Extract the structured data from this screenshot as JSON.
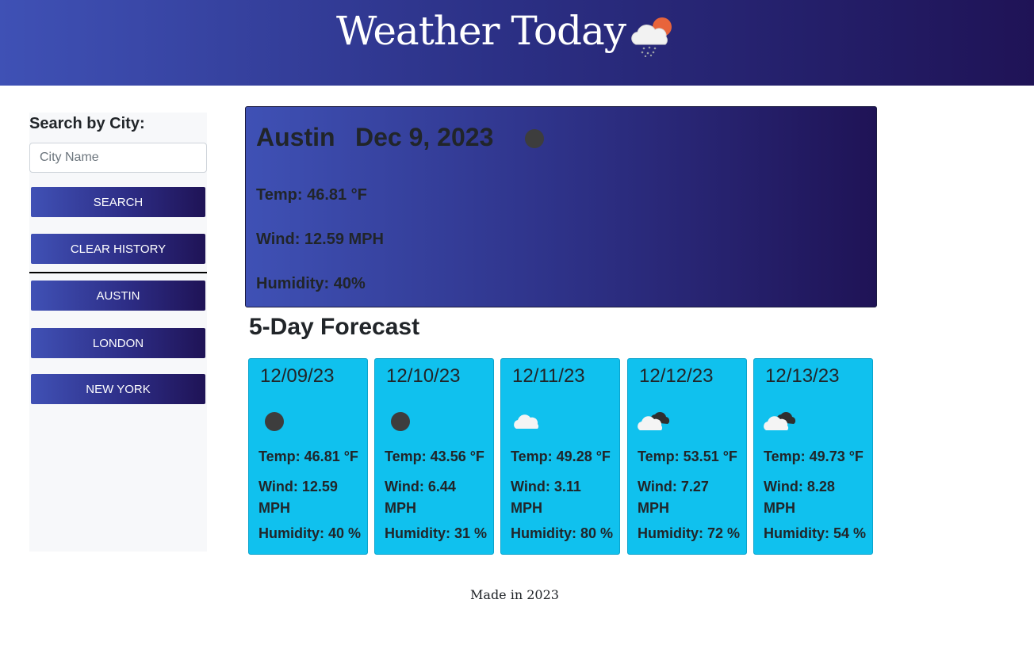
{
  "header": {
    "title": "Weather Today",
    "icon": "cloud-sun-rain-icon"
  },
  "sidebar": {
    "search_label": "Search by City:",
    "city_input_placeholder": "City Name",
    "city_input_value": "",
    "search_button": "Search",
    "clear_history_button": "Clear History",
    "history": [
      "Austin",
      "London",
      "New York"
    ]
  },
  "current": {
    "city": "Austin",
    "date": "Dec 9, 2023",
    "icon": "clear-night-moon-icon",
    "temp": "Temp: 46.81 °F",
    "wind": "Wind: 12.59 MPH",
    "humidity": "Humidity: 40%"
  },
  "forecast": {
    "title": "5-Day Forecast",
    "days": [
      {
        "date": "12/09/23",
        "icon": "clear-night-moon-icon",
        "temp": "Temp: 46.81 °F",
        "wind": "Wind: 12.59 MPH",
        "humidity": "Humidity: 40 %"
      },
      {
        "date": "12/10/23",
        "icon": "clear-night-moon-icon",
        "temp": "Temp: 43.56 °F",
        "wind": "Wind: 6.44 MPH",
        "humidity": "Humidity: 31 %"
      },
      {
        "date": "12/11/23",
        "icon": "cloud-icon",
        "temp": "Temp: 49.28 °F",
        "wind": "Wind: 3.11 MPH",
        "humidity": "Humidity: 80 %"
      },
      {
        "date": "12/12/23",
        "icon": "broken-clouds-icon",
        "temp": "Temp: 53.51 °F",
        "wind": "Wind: 7.27 MPH",
        "humidity": "Humidity: 72 %"
      },
      {
        "date": "12/13/23",
        "icon": "broken-clouds-icon",
        "temp": "Temp: 49.73 °F",
        "wind": "Wind: 8.28 MPH",
        "humidity": "Humidity: 54 %"
      }
    ]
  },
  "footer": {
    "text": "Made in 2023"
  },
  "colors": {
    "header_gradient_start": "#3f51b5",
    "header_gradient_end": "#1f1356",
    "forecast_card": "#10c1ee",
    "sidebar_bg": "#f7f8fa"
  }
}
